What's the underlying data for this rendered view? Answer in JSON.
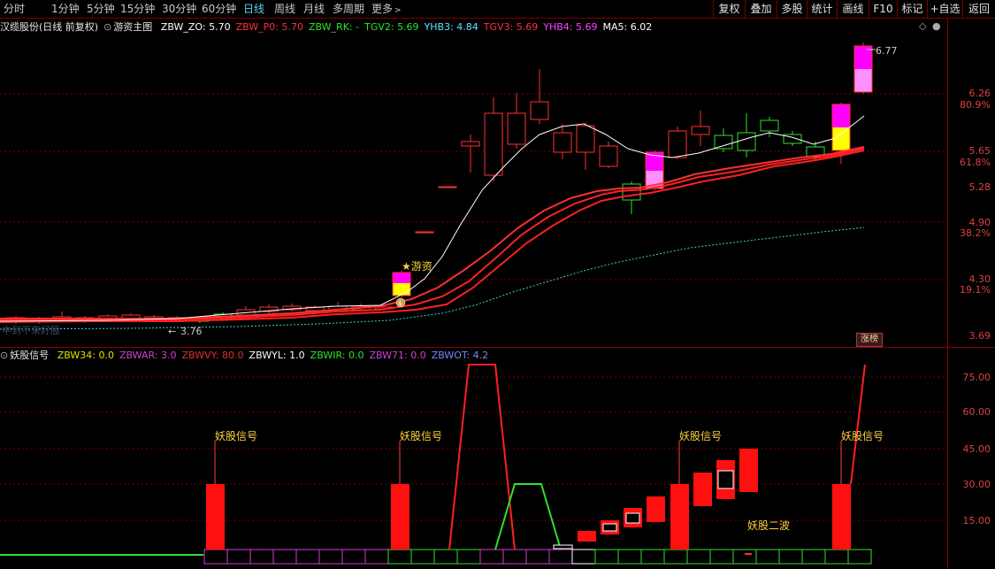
{
  "toolbar": {
    "timeframes": [
      "分时",
      "1分钟",
      "5分钟",
      "15分钟",
      "30分钟",
      "60分钟",
      "日线",
      "周线",
      "月线",
      "多周期",
      "更多"
    ],
    "active": "日线",
    "more_arrow": ">",
    "right_buttons": [
      "复权",
      "叠加",
      "多股",
      "统计",
      "画线",
      "F10",
      "标记",
      "+自选",
      "返回"
    ]
  },
  "main_panel": {
    "title": "汉缆股份(日线 前复权)",
    "indicator": "游资主图",
    "legend": [
      {
        "label": "ZBW_ZO: 5.70",
        "color": "#ffffff"
      },
      {
        "label": "ZBW_P0: 5.70",
        "color": "#ff3030"
      },
      {
        "label": "ZBW_RK: -",
        "color": "#30e030"
      },
      {
        "label": "TGV2: 5.69",
        "color": "#30e030"
      },
      {
        "label": "YHB3: 4.84",
        "color": "#60e0ff"
      },
      {
        "label": "TGV3: 5.69",
        "color": "#ff3030"
      },
      {
        "label": "YHB4: 5.69",
        "color": "#ff40ff"
      },
      {
        "label": "MA5: 6.02",
        "color": "#ffffff"
      }
    ],
    "price_axis": [
      "6.26",
      "5.65",
      "5.28",
      "4.90",
      "4.30",
      "3.69"
    ],
    "pct_axis": [
      "80.9%",
      "61.8%",
      "38.2%",
      "19.1%"
    ],
    "high_label": "6.77",
    "low_label": "3.76",
    "low_arrow": "←",
    "badge": "涨榜",
    "star_label": "★游资",
    "bag_icon": "money-bag-icon",
    "faded_text": "中到不来好股"
  },
  "sub_panel": {
    "indicator": "妖股信号",
    "legend": [
      {
        "label": "ZBW34: 0.0",
        "color": "#e0e000"
      },
      {
        "label": "ZBWAR: 3.0",
        "color": "#d040d0"
      },
      {
        "label": "ZBWVY: 80.0",
        "color": "#e03030"
      },
      {
        "label": "ZBWYL: 1.0",
        "color": "#ffffff"
      },
      {
        "label": "ZBWIR: 0.0",
        "color": "#30e030"
      },
      {
        "label": "ZBW71: 0.0",
        "color": "#d040d0"
      },
      {
        "label": "ZBWOT: 4.2",
        "color": "#8080ff"
      }
    ],
    "axis": [
      "75.00",
      "60.00",
      "45.00",
      "30.00",
      "15.00"
    ],
    "signal_label": "妖股信号",
    "second_wave_label": "妖股二波"
  },
  "colors": {
    "up": "#ff3030",
    "down": "#30e030",
    "grid": "#8b0000",
    "ma_white": "#ffffff",
    "cyan_dotted": "#40d0d0",
    "magenta": "#ff00ff",
    "yellow": "#ffff00",
    "signal_yellow": "#ffd040"
  }
}
